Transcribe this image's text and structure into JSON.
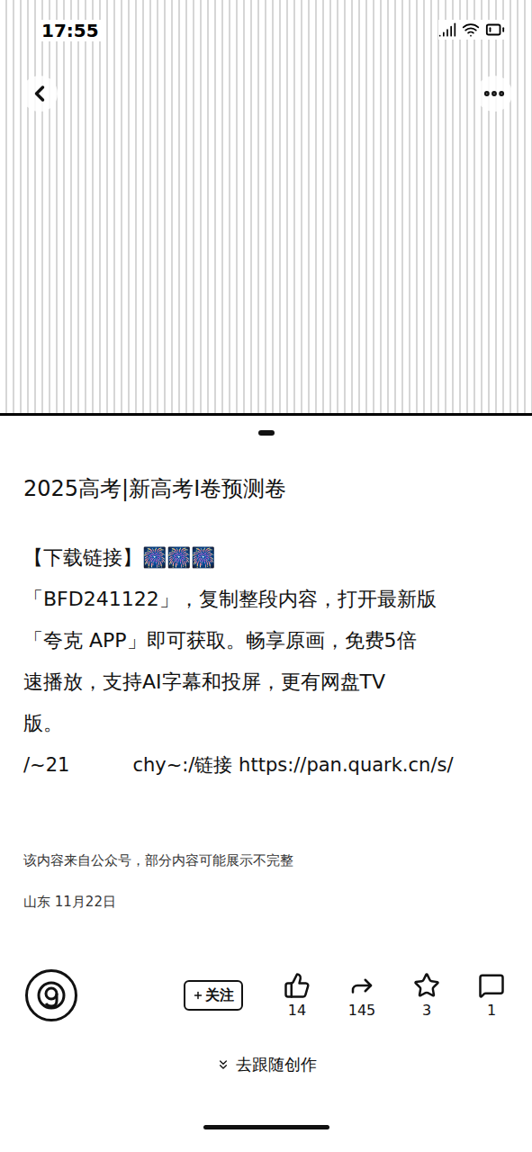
{
  "status_bar": {
    "time": "17:55"
  },
  "carousel": {
    "dots": [
      {
        "selected": true
      }
    ]
  },
  "post": {
    "title": "2025高考|新高考I卷预测卷",
    "lines": [
      "【下载链接】🎆🎆🎆",
      "「BFD241122」，复制整段内容，打开最新版",
      "「夸克 APP」即可获取。畅享原画，免费5倍",
      "速播放，支持AI字幕和投屏，更有网盘TV",
      "版。"
    ],
    "link_parts": [
      "/~21",
      "chy~:/链接 https://pan.quark.cn/s/"
    ],
    "note": "该内容来自公众号，部分内容可能展示不完整",
    "meta": "山东 11月22日"
  },
  "toolbar": {
    "follow": {
      "label": "关注"
    },
    "actions": [
      {
        "kind": "like",
        "count": "14"
      },
      {
        "kind": "share",
        "count": "145"
      },
      {
        "kind": "collect",
        "count": "3"
      },
      {
        "kind": "comment",
        "count": "1"
      }
    ]
  },
  "footer": {
    "label": "去跟随创作"
  }
}
